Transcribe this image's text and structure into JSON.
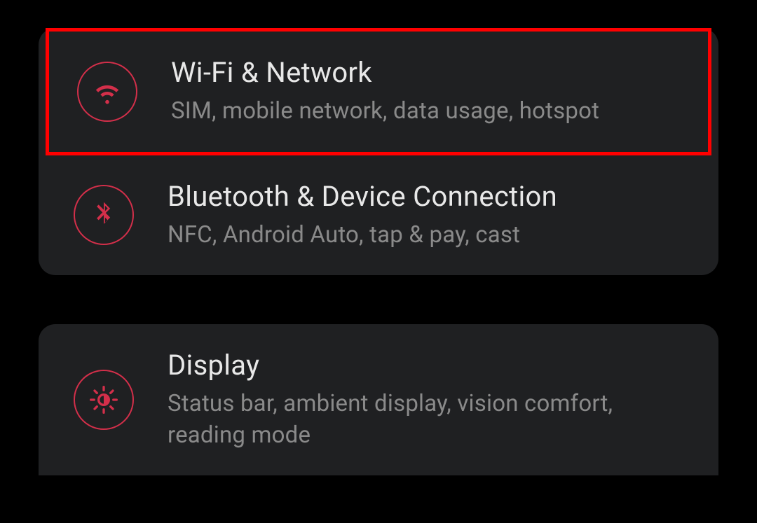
{
  "highlight_color": "#ff0000",
  "accent_color": "#d32f4a",
  "groups": [
    {
      "items": [
        {
          "id": "wifi-network",
          "title": "Wi-Fi & Network",
          "subtitle": "SIM, mobile network, data usage, hotspot",
          "icon": "wifi-icon",
          "highlighted": true
        },
        {
          "id": "bluetooth-device",
          "title": "Bluetooth & Device Connection",
          "subtitle": "NFC, Android Auto, tap & pay, cast",
          "icon": "bluetooth-icon",
          "highlighted": false
        }
      ]
    },
    {
      "items": [
        {
          "id": "display",
          "title": "Display",
          "subtitle": "Status bar, ambient display, vision comfort, reading mode",
          "icon": "brightness-icon",
          "highlighted": false
        }
      ]
    }
  ]
}
